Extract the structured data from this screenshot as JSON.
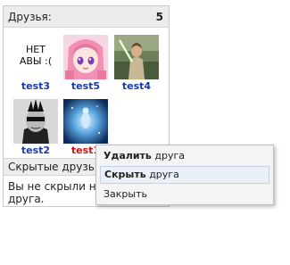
{
  "panel": {
    "title": "Друзья:",
    "count": "5"
  },
  "friends": [
    {
      "name": "test3",
      "avatar": "no-avatar",
      "noava_text": "НЕТ АВЫ :("
    },
    {
      "name": "test5",
      "avatar": "anime-girl"
    },
    {
      "name": "test4",
      "avatar": "jedi"
    },
    {
      "name": "test2",
      "avatar": "mohawk-man"
    },
    {
      "name": "test1",
      "avatar": "blue-light"
    }
  ],
  "hidden": {
    "title": "Скрытые друзья:",
    "text": "Вы не скрыли ни одного друга."
  },
  "context_menu": {
    "items": [
      {
        "bold": "Удалить",
        "rest": " друга"
      },
      {
        "bold": "Скрыть",
        "rest": " друга"
      },
      {
        "bold": "",
        "rest": "Закрыть"
      }
    ]
  },
  "colors": {
    "link": "#1a3aa8",
    "link_highlight": "#cc1111",
    "header_bg": "#ececec"
  }
}
